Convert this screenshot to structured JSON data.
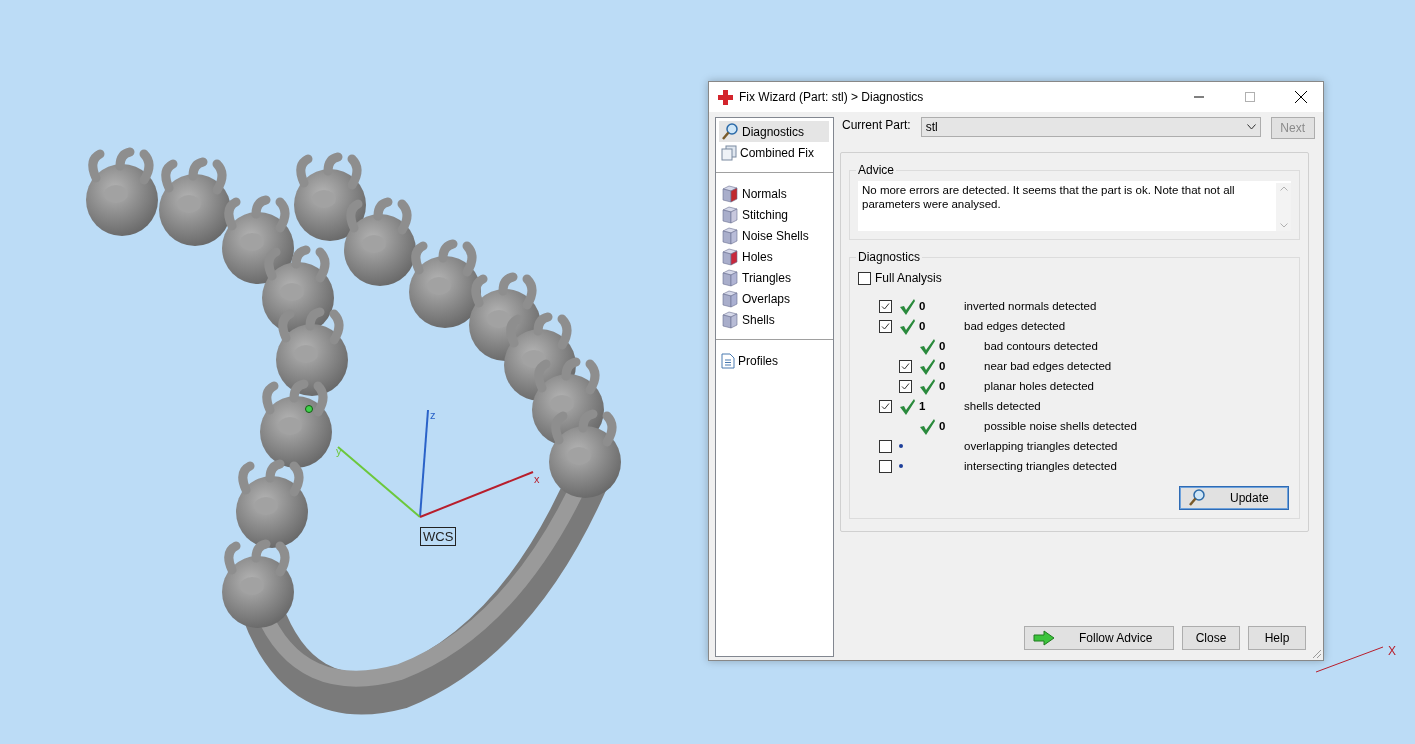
{
  "viewport": {
    "axes": [
      {
        "kind": "z",
        "label": "z"
      },
      {
        "kind": "y",
        "label": "y"
      },
      {
        "kind": "x",
        "label": "x"
      }
    ],
    "wcs_label": "WCS",
    "corner_axes": [
      {
        "kind": "x",
        "label": "X"
      }
    ]
  },
  "dialog": {
    "title": "Fix Wizard (Part: stl) > Diagnostics",
    "nav": [
      {
        "kind": "tools",
        "items": [
          {
            "label": "Diagnostics",
            "selected": true
          },
          {
            "label": "Combined Fix",
            "selected": false
          }
        ]
      },
      {
        "kind": "fixes",
        "items": [
          {
            "label": "Normals",
            "selected": false
          },
          {
            "label": "Stitching",
            "selected": false
          },
          {
            "label": "Noise Shells",
            "selected": false
          },
          {
            "label": "Holes",
            "selected": false
          },
          {
            "label": "Triangles",
            "selected": false
          },
          {
            "label": "Overlaps",
            "selected": false
          },
          {
            "label": "Shells",
            "selected": false
          }
        ]
      },
      {
        "kind": "profiles",
        "items": [
          {
            "label": "Profiles",
            "selected": false
          }
        ]
      }
    ],
    "current_part": {
      "label": "Current Part:",
      "value": "stl"
    },
    "next_button": {
      "label": "Next",
      "disabled": true
    },
    "advice": {
      "title": "Advice",
      "text": "No more errors are detected. It seems that the part is ok. Note that not all parameters were analysed."
    },
    "diagnostics": {
      "title": "Diagnostics",
      "full_analysis": {
        "label": "Full Analysis",
        "checked": false
      },
      "rows": [
        {
          "kind": "checkable",
          "checked": true,
          "passed": true,
          "count": "0",
          "label": "inverted normals detected"
        },
        {
          "kind": "checkable",
          "checked": true,
          "passed": true,
          "count": "0",
          "label": "bad edges detected",
          "children": [
            {
              "kind": "info",
              "passed": true,
              "count": "0",
              "label": "bad contours detected"
            },
            {
              "kind": "checkable",
              "checked": true,
              "passed": true,
              "count": "0",
              "label": "near bad edges detected"
            },
            {
              "kind": "checkable",
              "checked": true,
              "passed": true,
              "count": "0",
              "label": "planar holes detected"
            }
          ]
        },
        {
          "kind": "checkable",
          "checked": true,
          "passed": true,
          "count": "1",
          "label": "shells detected",
          "children": [
            {
              "kind": "info",
              "passed": true,
              "count": "0",
              "label": "possible noise shells detected"
            }
          ]
        },
        {
          "kind": "checkable",
          "checked": false,
          "passed": false,
          "label": "overlapping triangles detected"
        },
        {
          "kind": "checkable",
          "checked": false,
          "passed": false,
          "label": "intersecting triangles detected"
        }
      ],
      "update_button": "Update"
    },
    "buttons": [
      {
        "kind": "follow",
        "label": "Follow Advice"
      },
      {
        "kind": "plain",
        "label": "Close"
      },
      {
        "kind": "plain",
        "label": "Help"
      }
    ]
  }
}
